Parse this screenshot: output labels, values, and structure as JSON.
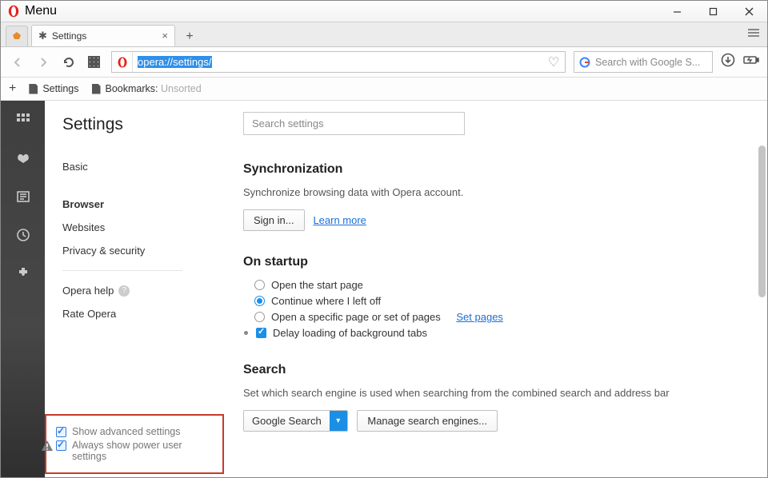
{
  "titlebar": {
    "menu_label": "Menu"
  },
  "tabs": {
    "active_label": "Settings"
  },
  "address": {
    "url": "opera://settings/",
    "search_placeholder": "Search with Google S..."
  },
  "bookmarks_bar": {
    "item1": "Settings",
    "item2_prefix": "Bookmarks: ",
    "item2_suffix": "Unsorted"
  },
  "settings": {
    "title": "Settings",
    "nav": {
      "basic": "Basic",
      "browser": "Browser",
      "websites": "Websites",
      "privacy": "Privacy & security",
      "help": "Opera help",
      "rate": "Rate Opera"
    },
    "bottom": {
      "show_advanced": "Show advanced settings",
      "power_user": "Always show power user settings"
    },
    "search_placeholder": "Search settings",
    "sync": {
      "heading": "Synchronization",
      "desc": "Synchronize browsing data with Opera account.",
      "signin": "Sign in...",
      "learn": "Learn more"
    },
    "startup": {
      "heading": "On startup",
      "opt1": "Open the start page",
      "opt2": "Continue where I left off",
      "opt3": "Open a specific page or set of pages",
      "opt3_link": "Set pages",
      "opt4": "Delay loading of background tabs"
    },
    "search": {
      "heading": "Search",
      "desc": "Set which search engine is used when searching from the combined search and address bar",
      "engine": "Google Search",
      "manage": "Manage search engines..."
    }
  }
}
